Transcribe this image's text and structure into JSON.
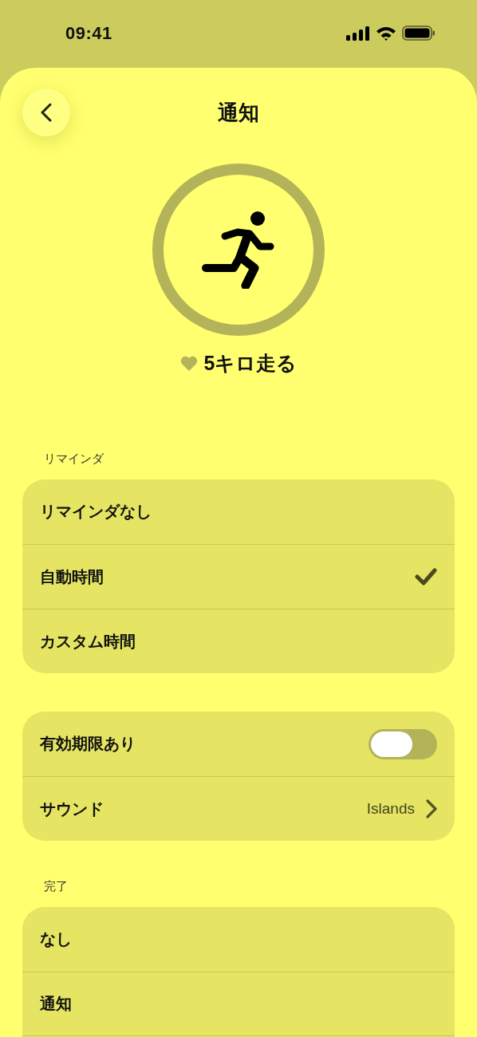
{
  "status_bar": {
    "time": "09:41"
  },
  "header": {
    "title": "通知"
  },
  "goal": {
    "title": "5キロ走る"
  },
  "sections": [
    {
      "kind": "choice",
      "header": "リマインダ",
      "items": [
        {
          "label": "リマインダなし",
          "selected": false
        },
        {
          "label": "自動時間",
          "selected": true
        },
        {
          "label": "カスタム時間",
          "selected": false
        }
      ]
    },
    {
      "kind": "settings",
      "items": [
        {
          "kind": "toggle",
          "label": "有効期限あり",
          "on": false
        },
        {
          "kind": "link",
          "label": "サウンド",
          "value": "Islands"
        }
      ]
    },
    {
      "kind": "choice",
      "header": "完了",
      "continues": true,
      "items": [
        {
          "label": "なし",
          "selected": false
        },
        {
          "label": "通知",
          "selected": false
        }
      ]
    }
  ]
}
